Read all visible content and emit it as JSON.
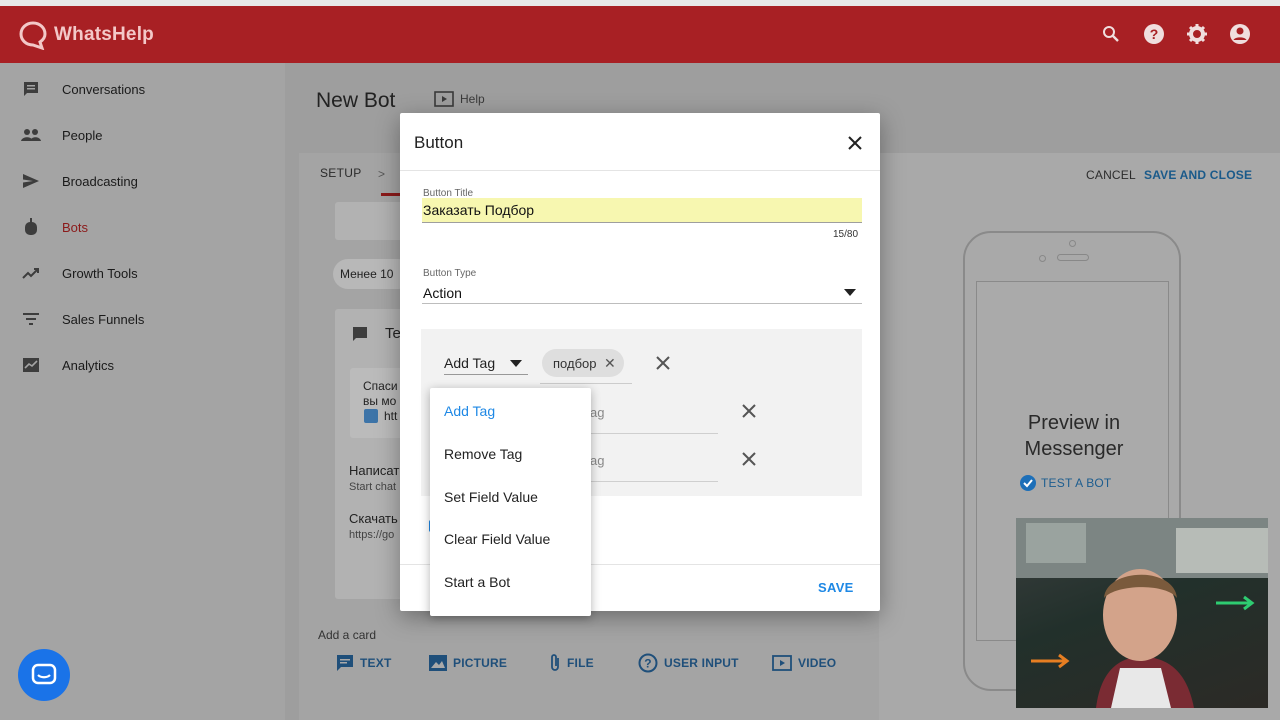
{
  "app": {
    "brand": "WhatsHelp",
    "colors": {
      "appbar": "#a82024",
      "accent": "#1e88e5",
      "active_nav": "#8b1a1a"
    },
    "icons": [
      "search-icon",
      "help-icon",
      "gear-icon",
      "account-icon"
    ]
  },
  "sidebar": {
    "items": [
      {
        "label": "Conversations",
        "icon": "chat-icon"
      },
      {
        "label": "People",
        "icon": "people-icon"
      },
      {
        "label": "Broadcasting",
        "icon": "send-icon"
      },
      {
        "label": "Bots",
        "icon": "bot-icon",
        "active": true
      },
      {
        "label": "Growth Tools",
        "icon": "trending-icon"
      },
      {
        "label": "Sales Funnels",
        "icon": "filter-icon"
      },
      {
        "label": "Analytics",
        "icon": "analytics-icon"
      }
    ]
  },
  "page": {
    "title": "New Bot",
    "help": "Help",
    "setup_tab": "SETUP",
    "tab_arrow": ">",
    "cancel": "CANCEL",
    "save_and_close": "SAVE AND CLOSE"
  },
  "background": {
    "pill": "Менее 10",
    "card_head": "Te",
    "msg_line1": "Спаси",
    "msg_line2": "вы мо",
    "msg_line3": "htt",
    "btn1_title": "Написат",
    "btn1_sub": "Start chat",
    "btn2_title": "Скачать",
    "btn2_sub": "https://go",
    "add_card": "Add a card",
    "card_actions": [
      {
        "label": "TEXT",
        "icon": "text-icon"
      },
      {
        "label": "PICTURE",
        "icon": "picture-icon"
      },
      {
        "label": "FILE",
        "icon": "attach-icon"
      },
      {
        "label": "USER INPUT",
        "icon": "question-icon"
      },
      {
        "label": "VIDEO",
        "icon": "video-icon"
      }
    ]
  },
  "preview": {
    "line1": "Preview in",
    "line2": "Messenger",
    "test": "TEST A BOT"
  },
  "dialog": {
    "title": "Button",
    "title_label": "Button Title",
    "title_value": "Заказать Подбор",
    "counter": "15/80",
    "type_label": "Button Type",
    "type_value": "Action",
    "action_value": "Add Tag",
    "chip": "подбор",
    "ghost1": "ag",
    "ghost2": "ag",
    "save": "SAVE",
    "dropdown": [
      {
        "label": "Add Tag",
        "selected": true
      },
      {
        "label": "Remove Tag"
      },
      {
        "label": "Set Field Value"
      },
      {
        "label": "Clear Field Value"
      },
      {
        "label": "Start a Bot"
      }
    ]
  }
}
